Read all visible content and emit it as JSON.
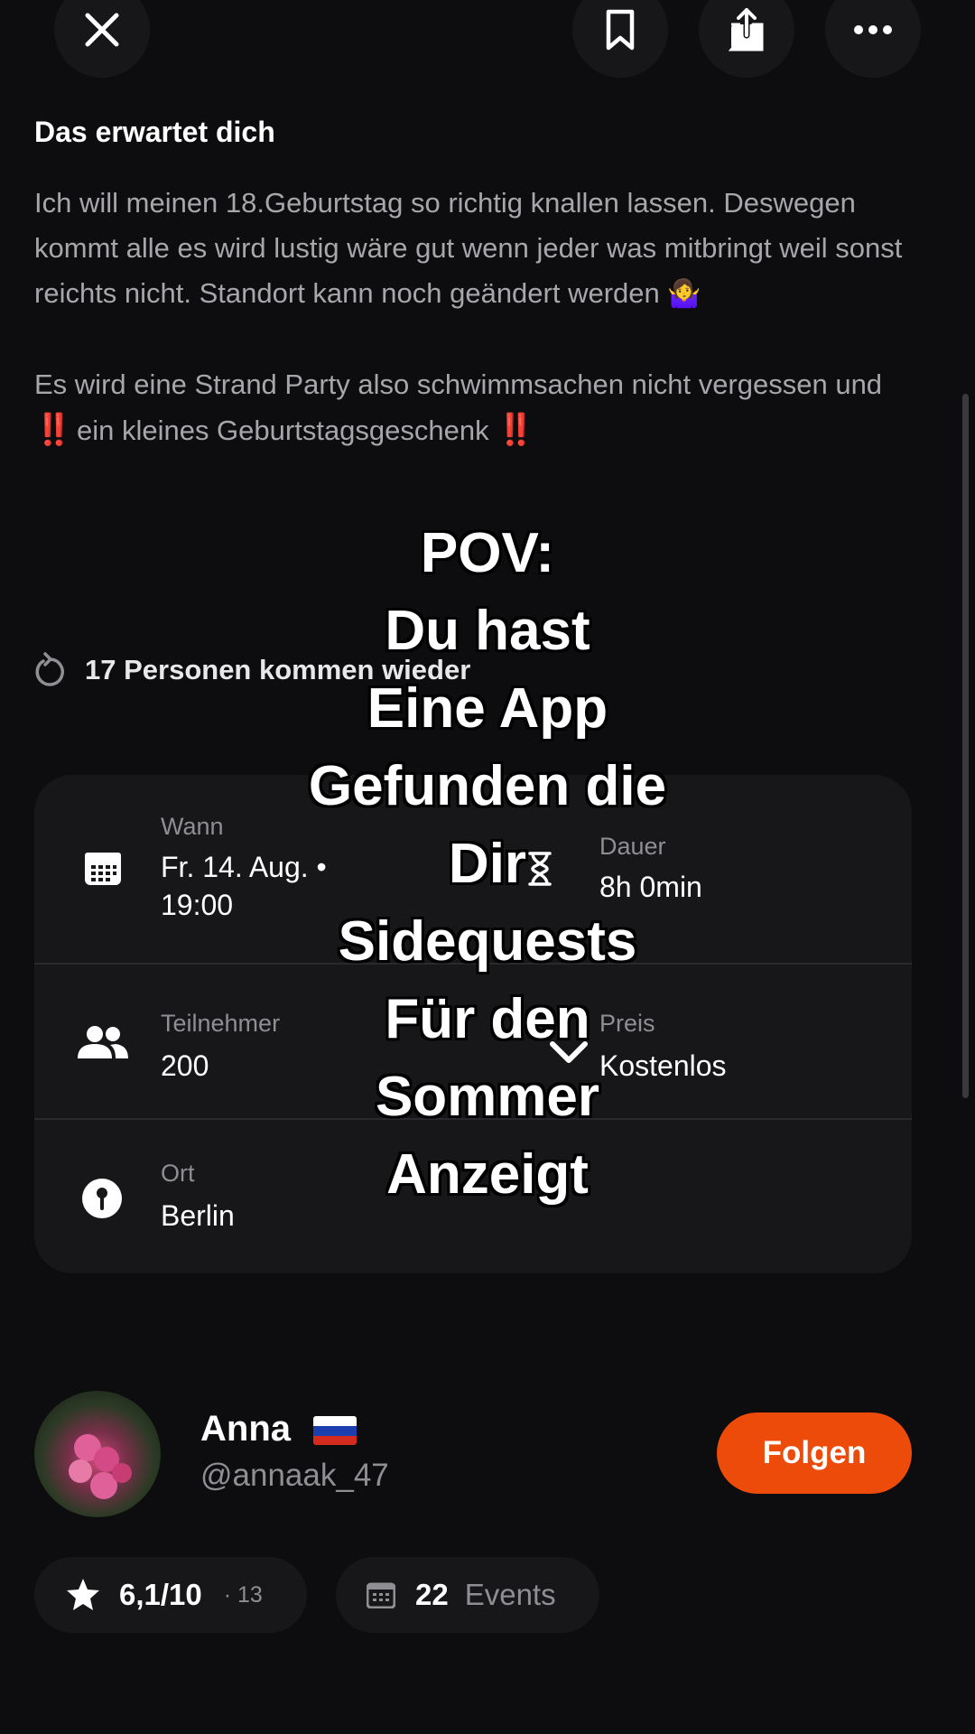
{
  "toolbar": {
    "close_icon": "close-icon",
    "bookmark_icon": "bookmark-icon",
    "share_icon": "share-icon",
    "more_icon": "more-icon"
  },
  "description": {
    "title": "Das erwartet dich",
    "paragraph1": "Ich will meinen 18.Geburtstag so richtig knallen lassen. Deswegen kommt alle es wird lustig wäre gut wenn jeder was mitbringt weil sonst reichts nicht. Standort kann noch geändert werden",
    "emoji1": "🤷‍♀️",
    "paragraph2": "Es wird eine Strand Party also schwimmsachen nicht vergessen und",
    "paragraph3_marker_left": "‼️",
    "paragraph3": "ein kleines Geburtstagsgeschenk",
    "paragraph3_marker_right": "‼️"
  },
  "returning": {
    "icon": "repeat-icon",
    "text": "17 Personen kommen wieder"
  },
  "details": {
    "when": {
      "label": "Wann",
      "value_line1": "Fr. 14. Aug. •",
      "value_line2": "19:00",
      "icon": "calendar-icon"
    },
    "duration": {
      "label": "Dauer",
      "value": "8h 0min",
      "icon": "hourglass-icon"
    },
    "participants": {
      "label": "Teilnehmer",
      "value": "200",
      "icon": "people-icon"
    },
    "price": {
      "label": "Preis",
      "value": "Kostenlos",
      "icon": "tag-icon"
    },
    "location": {
      "label": "Ort",
      "value": "Berlin",
      "icon": "location-pin-icon"
    }
  },
  "overlay": {
    "lines": [
      "POV:",
      "Du hast",
      "Eine App",
      "Gefunden die",
      "Dir",
      "Sidequests",
      "Für den",
      "Sommer",
      "Anzeigt"
    ]
  },
  "host": {
    "name": "Anna",
    "flag": "russian-flag",
    "handle": "@annaak_47",
    "follow_label": "Folgen"
  },
  "stats": {
    "rating": "6,1/10",
    "rating_count": "· 13",
    "events_count": "22",
    "events_label": "Events"
  },
  "colors": {
    "background": "#0d0d0f",
    "card": "#17171a",
    "accent": "#ec4b0a",
    "muted_text": "#a7a7ab"
  }
}
